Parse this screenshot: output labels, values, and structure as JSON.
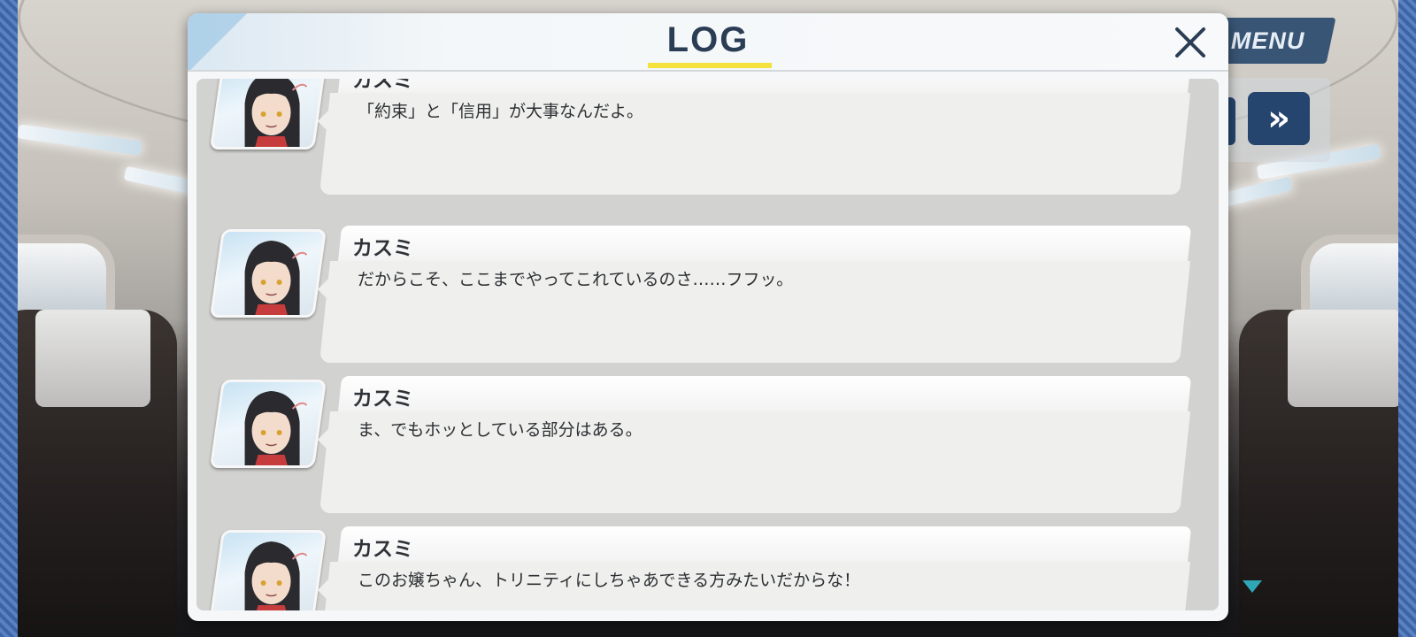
{
  "dialog": {
    "title": "LOG",
    "close_icon": "close-icon",
    "accent_color": "#f3e23b"
  },
  "hud": {
    "menu_label": "MENU",
    "fast_forward_icon": "fast-forward-icon",
    "next_indicator_icon": "down-triangle-icon"
  },
  "log": {
    "entries": [
      {
        "speaker": "カスミ",
        "text": "「約束」と「信用」が大事なんだよ。"
      },
      {
        "speaker": "カスミ",
        "text": "だからこそ、ここまでやってこれているのさ……フフッ。"
      },
      {
        "speaker": "カスミ",
        "text": "ま、でもホッとしている部分はある。"
      },
      {
        "speaker": "カスミ",
        "text": "このお嬢ちゃん、トリニティにしちゃあできる方みたいだからな！"
      }
    ]
  }
}
